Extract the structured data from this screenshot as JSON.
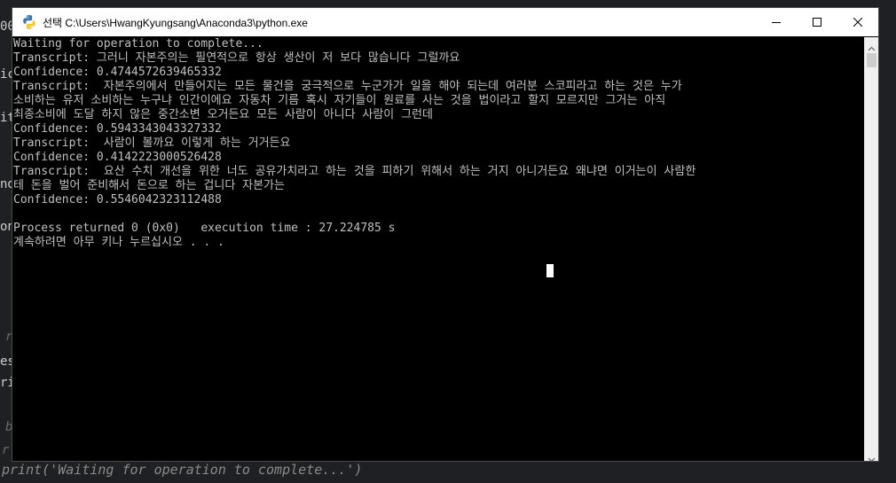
{
  "background_editor": {
    "fragments": [
      "00",
      "ic",
      "it",
      "nd",
      "on",
      "es",
      "ri",
      "r",
      "b",
      "r"
    ],
    "bottom_code": "print('Waiting for operation to complete...')"
  },
  "window": {
    "title": "선택 C:\\Users\\HwangKyungsang\\Anaconda3\\python.exe",
    "icon": "python-icon",
    "controls": {
      "minimize_icon": "minimize-icon",
      "maximize_icon": "maximize-icon",
      "close_icon": "close-icon"
    }
  },
  "console": {
    "lines": [
      "Waiting for operation to complete...",
      "Transcript: 그러니 자본주의는 필연적으로 항상 생산이 저 보다 많습니다 그럴까요",
      "Confidence: 0.4744572639465332",
      "Transcript:  자본주의에서 만들어지는 모든 물건을 궁극적으로 누군가가 일을 해야 되는데 여러분 스코피라고 하는 것은 누가",
      "소비하는 유저 소비하는 누구냐 인간이에요 자동차 기름 혹시 자기들이 원료를 사는 것을 법이라고 할지 모르지만 그거는 아직",
      "최종소비에 도달 하지 않은 중간소변 오거든요 모든 사람이 아니다 사람이 그런데",
      "Confidence: 0.5943343043327332",
      "Transcript:  사람이 볼까요 이렇게 하는 거거든요",
      "Confidence: 0.4142223000526428",
      "Transcript:  요산 수치 개선을 위한 너도 공유가치라고 하는 것을 피하기 위해서 하는 거지 아니거든요 왜냐면 이거는이 사람한",
      "테 돈을 벌어 준비해서 돈으로 하는 겁니다 자본가는",
      "Confidence: 0.5546042323112488",
      "",
      "Process returned 0 (0x0)   execution time : 27.224785 s",
      "계속하려면 아무 키나 누르십시오 . . ."
    ]
  },
  "colors": {
    "console_bg": "#000000",
    "console_text": "#c0c0c0",
    "titlebar_bg": "#ffffff"
  }
}
